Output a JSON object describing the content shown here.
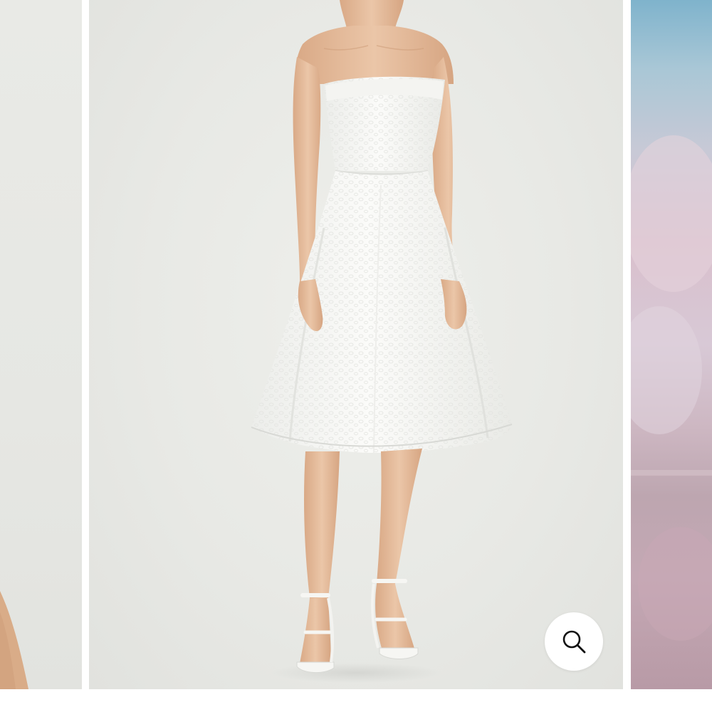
{
  "gallery": {
    "slides": [
      {
        "role": "previous",
        "icon": "product-photo-partial"
      },
      {
        "role": "current",
        "icon": "product-photo-white-strapless-dress"
      },
      {
        "role": "next",
        "icon": "product-photo-partial"
      }
    ],
    "zoom_button": {
      "icon": "search-icon"
    }
  },
  "colors": {
    "background": "#ffffff",
    "photo_backdrop": "#e8e9e5",
    "dress": "#f7f7f4",
    "skin": "#e3bb9a",
    "zoom_icon": "#111111"
  }
}
